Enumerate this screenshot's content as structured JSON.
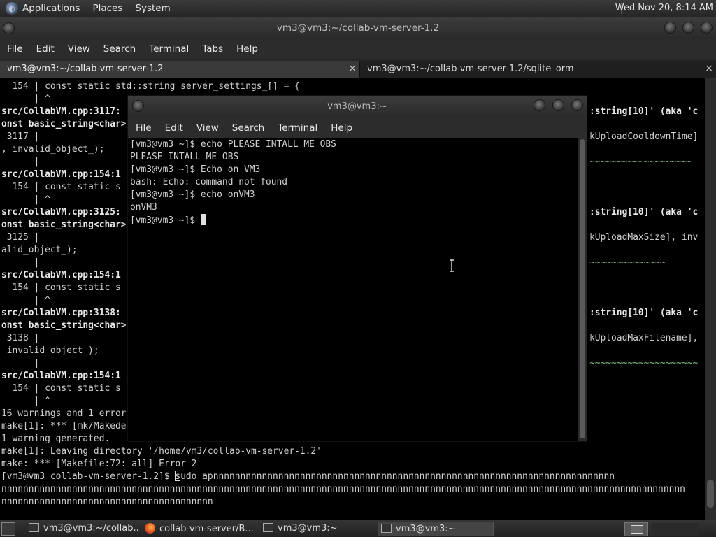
{
  "top_panel": {
    "menus": [
      "Applications",
      "Places",
      "System"
    ],
    "clock": "Wed Nov 20,  8:14 AM"
  },
  "back_window": {
    "title": "vm3@vm3:~/collab-vm-server-1.2",
    "menus": [
      "File",
      "Edit",
      "View",
      "Search",
      "Terminal",
      "Tabs",
      "Help"
    ],
    "tabs": [
      {
        "label": "vm3@vm3:~/collab-vm-server-1.2",
        "close": "×"
      },
      {
        "label": "vm3@vm3:~/collab-vm-server-1.2/sqlite_orm",
        "close": "×"
      }
    ],
    "lines": [
      "  154 | const static std::string server_settings_[] = {",
      "      | ^",
      "src/CollabVM.cpp:3117:",
      "onst basic_string<char>",
      " 3117 |",
      ", invalid_object_);",
      "      |",
      "src/CollabVM.cpp:154:1",
      "  154 | const static s",
      "      | ^",
      "src/CollabVM.cpp:3125:",
      "onst basic_string<char>",
      " 3125 |",
      "alid_object_);",
      "      |",
      "src/CollabVM.cpp:154:1",
      "  154 | const static s",
      "      | ^",
      "src/CollabVM.cpp:3138:",
      "onst basic_string<char>",
      " 3138 |",
      " invalid_object_);",
      "      |",
      "src/CollabVM.cpp:154:1",
      "  154 | const static s",
      "      | ^",
      "16 warnings and 1 error",
      "make[1]: *** [mk/Makede",
      "1 warning generated.",
      "make[1]: Leaving directory '/home/vm3/collab-vm-server-1.2'",
      "make: *** [Makefile:72: all] Error 2"
    ],
    "prompt_line_prefix": "[vm3@vm3 collab-vm-server-1.2]$ ",
    "prompt_cursor_char": "s",
    "prompt_line_rest": "udo apnnnnnnnnnnnnnnnnnnnnnnnnnnnnnnnnnnnnnnnnnnnnnnnnnnnnnnnnnnnnnnnnnnnnnnnnnn",
    "wrap_line_1": "nnnnnnnnnnnnnnnnnnnnnnnnnnnnnnnnnnnnnnnnnnnnnnnnnnnnnnnnnnnnnnnnnnnnnnnnnnnnnnnnnnnnnnnnnnnnnnnnnnnnnnnnnnnnnnnnnnnnnnnnnnnnnn",
    "wrap_line_2": "nnnnnnnnnnnnnnnnnnnnnnnnnnnnnnnnnnnnnnn",
    "right_fragments": [
      ":string[10]' (aka 'c",
      "kUploadCooldownTime]",
      "~~~~~~~~~~~~~~~~~~~",
      ":string[10]' (aka 'c",
      "kUploadMaxSize], inv",
      "~~~~~~~~~~~~~~",
      ":string[10]' (aka 'c",
      "kUploadMaxFilename],",
      "~~~~~~~~~~~~~~~~~~~~"
    ]
  },
  "front_window": {
    "title": "vm3@vm3:~",
    "menus": [
      "File",
      "Edit",
      "View",
      "Search",
      "Terminal",
      "Help"
    ],
    "lines": [
      "[vm3@vm3 ~]$ echo PLEASE INTALL ME OBS",
      "PLEASE INTALL ME OBS",
      "[vm3@vm3 ~]$ Echo on VM3",
      "bash: Echo: command not found",
      "[vm3@vm3 ~]$ echo onVM3",
      "onVM3",
      "[vm3@vm3 ~]$ "
    ]
  },
  "taskbar": {
    "items": [
      {
        "label": "vm3@vm3:~/collab...",
        "icon": "terminal-icon"
      },
      {
        "label": "collab-vm-server/B...",
        "icon": "firefox-icon"
      },
      {
        "label": "vm3@vm3:~",
        "icon": "terminal-icon"
      },
      {
        "label": "vm3@vm3:~",
        "icon": "terminal-icon"
      }
    ]
  }
}
